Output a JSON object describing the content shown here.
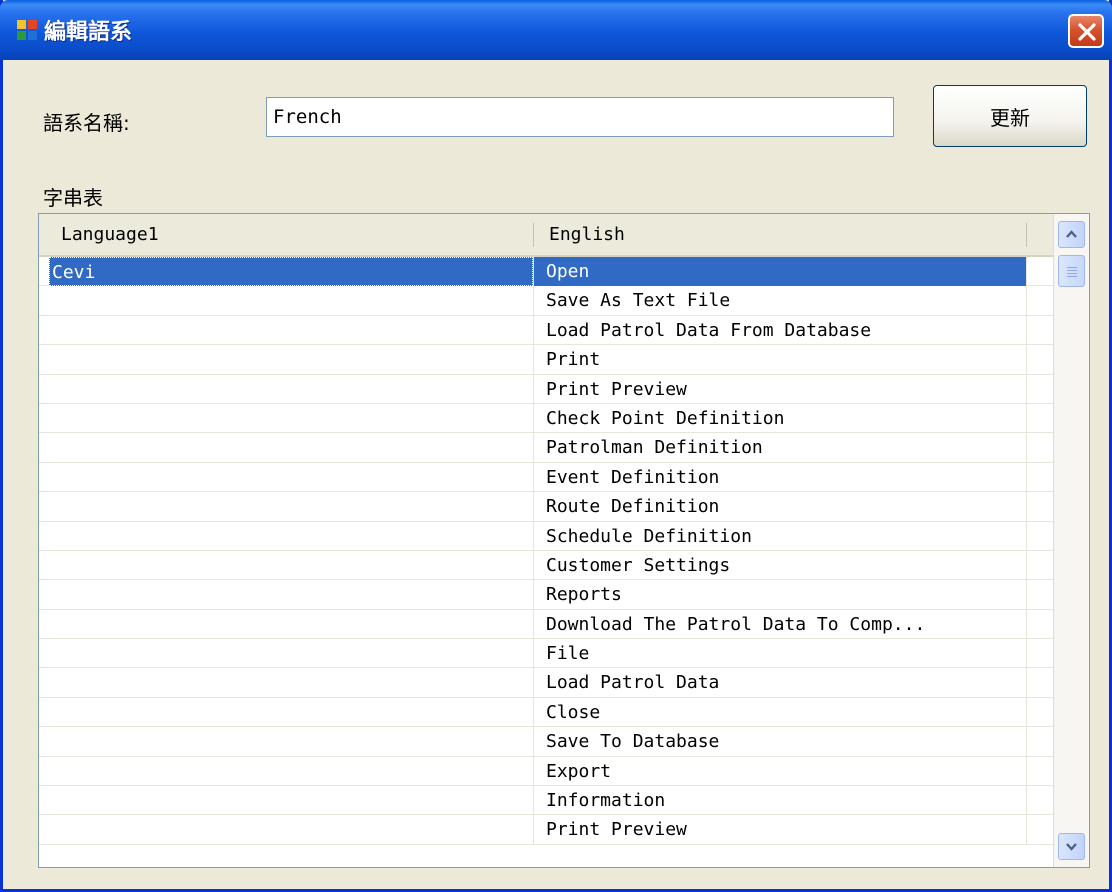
{
  "window": {
    "title": "編輯語系"
  },
  "form": {
    "language_name_label": "語系名稱:",
    "language_name_value": "French",
    "update_button": "更新",
    "string_table_label": "字串表"
  },
  "grid": {
    "columns": [
      "Language1",
      "English"
    ],
    "rows": [
      {
        "lang": "Cevi",
        "english": "Open",
        "selected": true
      },
      {
        "lang": "",
        "english": "Save As Text File"
      },
      {
        "lang": "",
        "english": "Load Patrol Data From Database"
      },
      {
        "lang": "",
        "english": "Print"
      },
      {
        "lang": "",
        "english": "Print Preview"
      },
      {
        "lang": "",
        "english": "Check Point Definition"
      },
      {
        "lang": "",
        "english": "Patrolman Definition"
      },
      {
        "lang": "",
        "english": "Event Definition"
      },
      {
        "lang": "",
        "english": "Route Definition"
      },
      {
        "lang": "",
        "english": "Schedule Definition"
      },
      {
        "lang": "",
        "english": "Customer Settings"
      },
      {
        "lang": "",
        "english": "Reports"
      },
      {
        "lang": "",
        "english": "Download The Patrol Data To Comp..."
      },
      {
        "lang": "",
        "english": "File"
      },
      {
        "lang": "",
        "english": "Load Patrol Data"
      },
      {
        "lang": "",
        "english": "Close"
      },
      {
        "lang": "",
        "english": "Save To Database"
      },
      {
        "lang": "",
        "english": "Export"
      },
      {
        "lang": "",
        "english": "Information"
      },
      {
        "lang": "",
        "english": "Print Preview"
      }
    ]
  },
  "icons": {
    "app": "app-window-icon",
    "close": "close-icon",
    "scroll_up": "chevron-up-icon",
    "scroll_down": "chevron-down-icon"
  },
  "colors": {
    "title_bar": "#0a4bc8",
    "selection": "#316ac5",
    "close_button": "#d6532f",
    "window_background": "#ece9d8"
  }
}
